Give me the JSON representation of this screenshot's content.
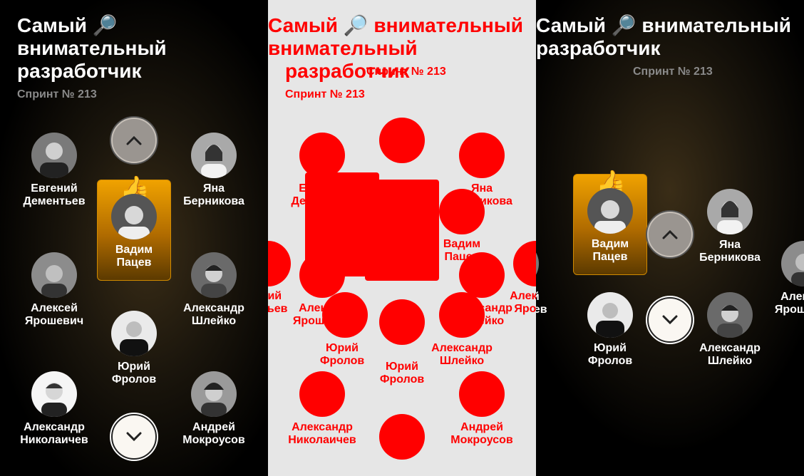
{
  "title": "Самый 🔎 внимательный разработчик",
  "title_line1": "Самый 🔎",
  "title_line2": "внимательный",
  "title_line3": "разработчик",
  "title_line_a": "Самый 🔎 внимательный",
  "subtitle": "Спринт № 213",
  "thumb": "👍",
  "people": {
    "evgeniy": {
      "first": "Евгений",
      "last": "Дементьев"
    },
    "yana": {
      "first": "Яна",
      "last": "Берникова"
    },
    "vadim": {
      "first": "Вадим",
      "last": "Пацев"
    },
    "aleksey": {
      "first": "Алексей",
      "last": "Ярошевич"
    },
    "shleyko": {
      "first": "Александр",
      "last": "Шлейко"
    },
    "yuriy": {
      "first": "Юрий",
      "last": "Фролов"
    },
    "nikolaichev": {
      "first": "Александр",
      "last": "Николаичев"
    },
    "andrey": {
      "first": "Андрей",
      "last": "Мокроусов"
    }
  },
  "partial": {
    "evgeniy_last": "ентьев",
    "evgeniy_first": "ений",
    "aleksey_first": "Алек",
    "aleksey_last": "Яроше"
  },
  "colors": {
    "accent": "#f0a200",
    "diff": "#ff0000",
    "bg_mid": "#e6e6e6"
  },
  "icons": {
    "up": "chevron-up-icon",
    "down": "chevron-down-icon",
    "search": "magnifier-emoji",
    "like": "thumbs-up-emoji"
  }
}
